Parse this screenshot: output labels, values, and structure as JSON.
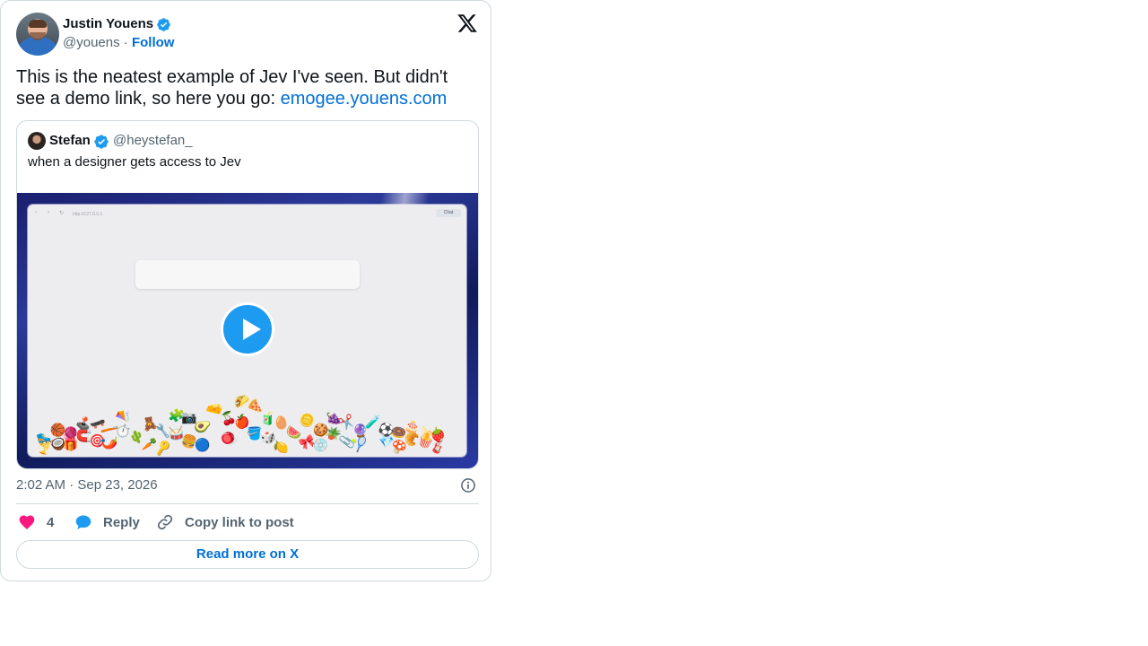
{
  "author": {
    "name": "Justin Youens",
    "handle": "@youens",
    "separator": "·",
    "follow_label": "Follow"
  },
  "tweet": {
    "text_before_link": "This is the neatest example of Jev I've seen. But didn't see a demo link, so here you go: ",
    "link_text": "emogee.youens.com"
  },
  "quoted": {
    "name": "Stefan",
    "handle": "@heystefan_",
    "text": "when a designer gets access to Jev",
    "media": {
      "url_text": "http://127.0.0.1",
      "chat_label": "Chat",
      "emojis": [
        "🎺",
        "⏱️",
        "🔵",
        "🥚",
        "🎾",
        "🍓",
        "🌶️",
        "📷",
        "🎲",
        "✂️",
        "🍿",
        "🛹",
        "🥁",
        "🍕",
        "🪴",
        "🎂",
        "🧲",
        "🔑",
        "🍎",
        "💿",
        "🍩",
        "🎁",
        "🧸",
        "🪀",
        "🪙",
        "💎",
        "🏀",
        "🌵",
        "🧀",
        "🍉",
        "🧪",
        "🛼",
        "🪁",
        "🥑",
        "🍋",
        "🔮",
        "🎸",
        "🪥",
        "🍔",
        "🧃",
        "📎",
        "🍌",
        "🎯",
        "🧩",
        "🪣",
        "🍇",
        "🥐",
        "🕹️",
        "🔧",
        "🌮",
        "🍪",
        "🍄",
        "🧶",
        "🥕",
        "🍒",
        "🎀",
        "⚽",
        "🥥"
      ]
    }
  },
  "timestamp": "2:02 AM · Sep 23, 2026",
  "actions": {
    "like_count": "4",
    "reply_label": "Reply",
    "copy_label": "Copy link to post"
  },
  "read_more_label": "Read more on X",
  "colors": {
    "link": "#006fd6",
    "verified": "#1d9bf0",
    "like": "#f91880",
    "reply": "#1d9bf0",
    "muted": "#536471"
  }
}
